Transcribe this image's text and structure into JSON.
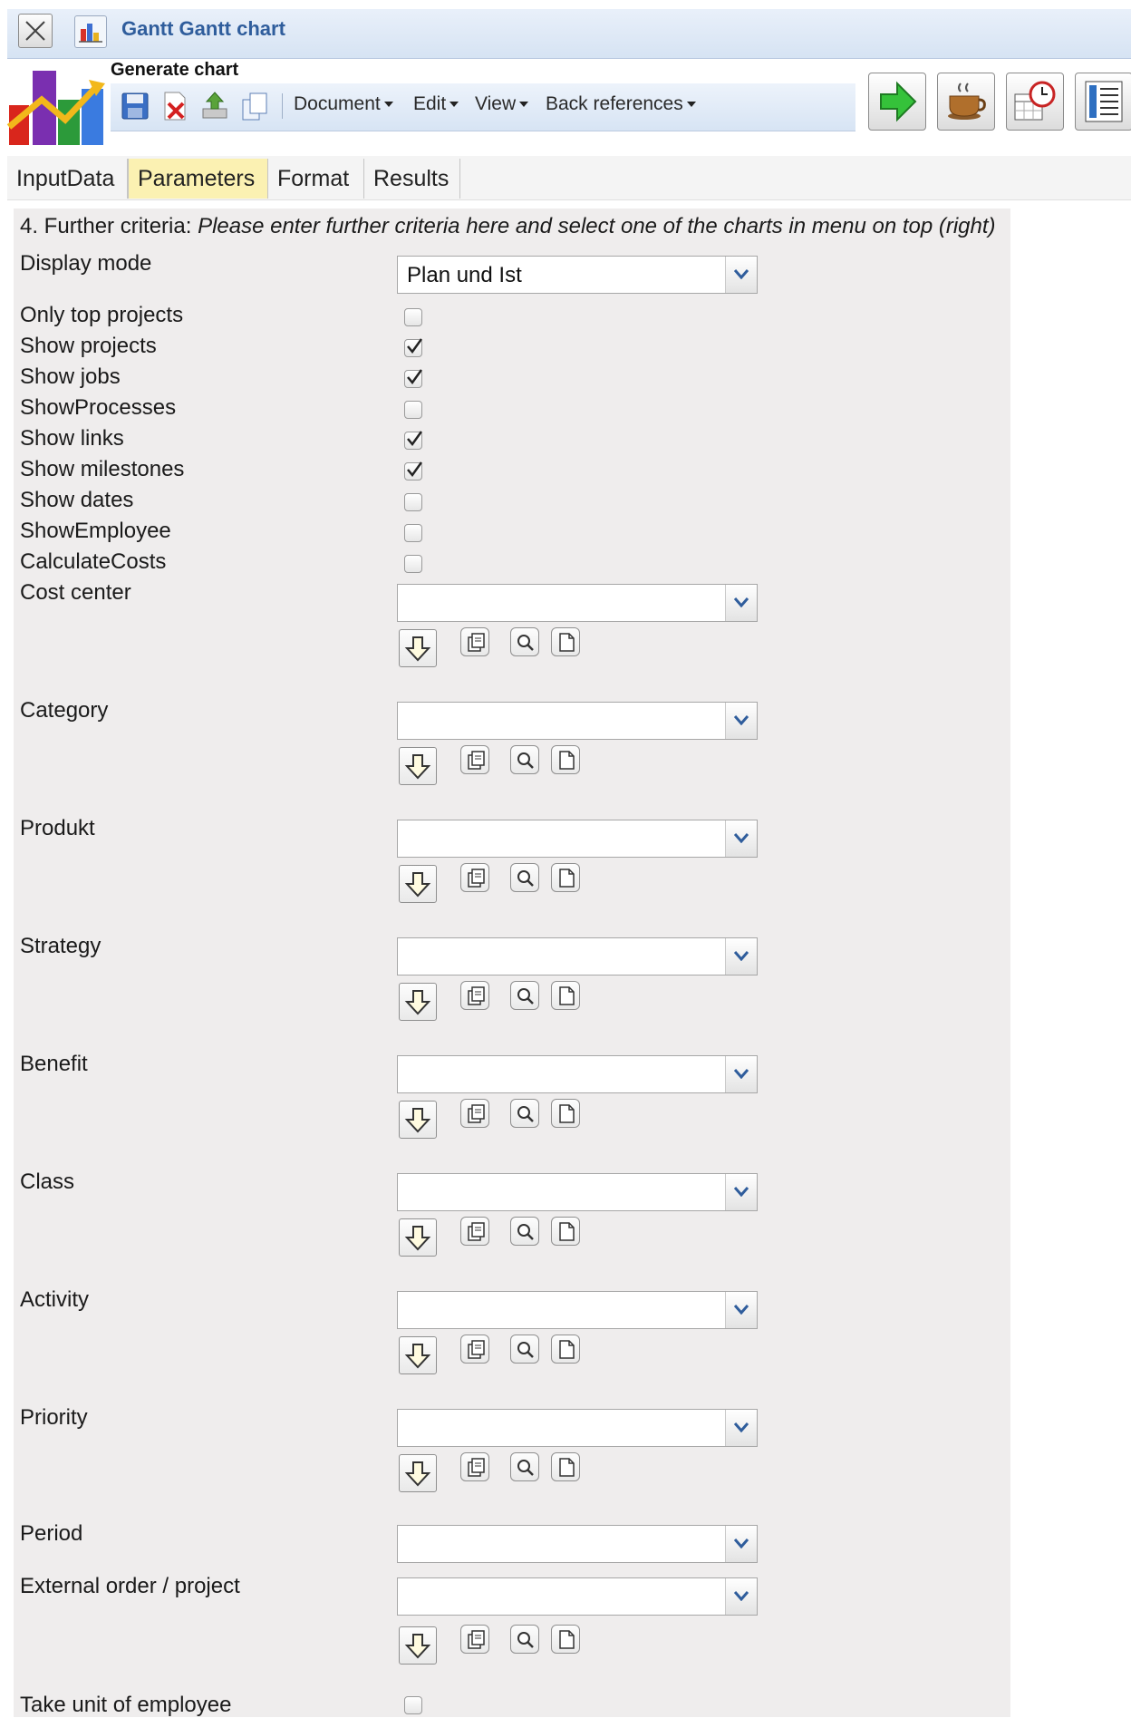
{
  "window": {
    "title": "Gantt Gantt chart"
  },
  "toolbar": {
    "label": "Generate chart",
    "menus": [
      "Document",
      "Edit",
      "View",
      "Back references"
    ]
  },
  "tabs": [
    {
      "label": "InputData",
      "active": false
    },
    {
      "label": "Parameters",
      "active": true
    },
    {
      "label": "Format",
      "active": false
    },
    {
      "label": "Results",
      "active": false
    }
  ],
  "form": {
    "header_prefix": "4. Further criteria: ",
    "header_text": "Please enter further criteria here and select one of the charts in menu on top (right)",
    "display_mode": {
      "label": "Display mode",
      "value": "Plan und Ist"
    },
    "checkboxes": [
      {
        "label": "Only top projects",
        "checked": false
      },
      {
        "label": "Show projects",
        "checked": true
      },
      {
        "label": "Show jobs",
        "checked": true
      },
      {
        "label": "ShowProcesses",
        "checked": false
      },
      {
        "label": "Show links",
        "checked": true
      },
      {
        "label": "Show milestones",
        "checked": true
      },
      {
        "label": "Show dates",
        "checked": false
      },
      {
        "label": "ShowEmployee",
        "checked": false
      },
      {
        "label": "CalculateCosts",
        "checked": false
      }
    ],
    "selectors": [
      {
        "label": "Cost center",
        "value": ""
      },
      {
        "label": "Category",
        "value": ""
      },
      {
        "label": "Produkt",
        "value": ""
      },
      {
        "label": "Strategy",
        "value": ""
      },
      {
        "label": "Benefit",
        "value": ""
      },
      {
        "label": "Class",
        "value": ""
      },
      {
        "label": "Activity",
        "value": ""
      },
      {
        "label": "Priority",
        "value": ""
      }
    ],
    "period": {
      "label": "Period",
      "value": ""
    },
    "external_order": {
      "label": "External order / project",
      "value": ""
    },
    "take_unit": {
      "label": "Take unit of employee",
      "checked": false
    }
  },
  "colors": {
    "title_text": "#2f5d9c",
    "active_tab": "#fbf1b2",
    "panel_bg": "#efeded"
  }
}
